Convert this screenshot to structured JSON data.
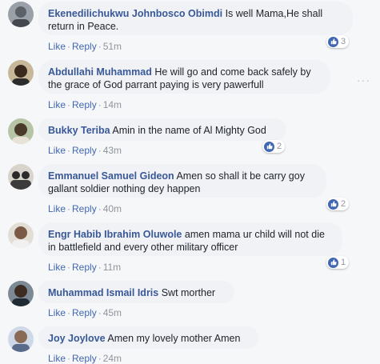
{
  "comments": [
    {
      "name": "Ekenedilichukwu Johnbosco Obimdi",
      "line1": " Is well Mama,He shall",
      "line2": "return in Peace.",
      "like": "Like",
      "reply": "Reply",
      "time": "51m",
      "reactions": "3"
    },
    {
      "name": "Abdullahi Muhammad",
      "line1": " He will go and come back safely by",
      "line2": "the grace of God parrant paying is very pawerfull",
      "like": "Like",
      "reply": "Reply",
      "time": "14m",
      "reactions": ""
    },
    {
      "name": "Bukky Teriba",
      "line1": " Amin in the name of Al Mighty God",
      "line2": "",
      "like": "Like",
      "reply": "Reply",
      "time": "43m",
      "reactions": "2"
    },
    {
      "name": "Emmanuel Samuel Gideon",
      "line1": " Amen so shall it be carry goy",
      "line2": "gallant soldier nothing dey happen",
      "like": "Like",
      "reply": "Reply",
      "time": "40m",
      "reactions": "2"
    },
    {
      "name": "Engr Habib Ibrahim Oluwole",
      "line1": " amen mama ur child will not die",
      "line2": "in battlefield and every other military officer",
      "like": "Like",
      "reply": "Reply",
      "time": "11m",
      "reactions": "1"
    },
    {
      "name": "Muhammad Ismail Idris",
      "line1": " Swt morther",
      "line2": "",
      "like": "Like",
      "reply": "Reply",
      "time": "45m",
      "reactions": ""
    },
    {
      "name": "Joy Joylove",
      "line1": " Amen my lovely mother Amen",
      "line2": "",
      "like": "Like",
      "reply": "Reply",
      "time": "24m",
      "reactions": ""
    }
  ],
  "icons": {
    "like_reaction": "thumbs-up-icon",
    "more_options": "more-options-icon"
  },
  "colors": {
    "name_link": "#385898",
    "action_link": "#4267b2",
    "bubble_bg": "#f1f2f6",
    "meta_gray": "#90949c"
  },
  "more_glyph": "···"
}
